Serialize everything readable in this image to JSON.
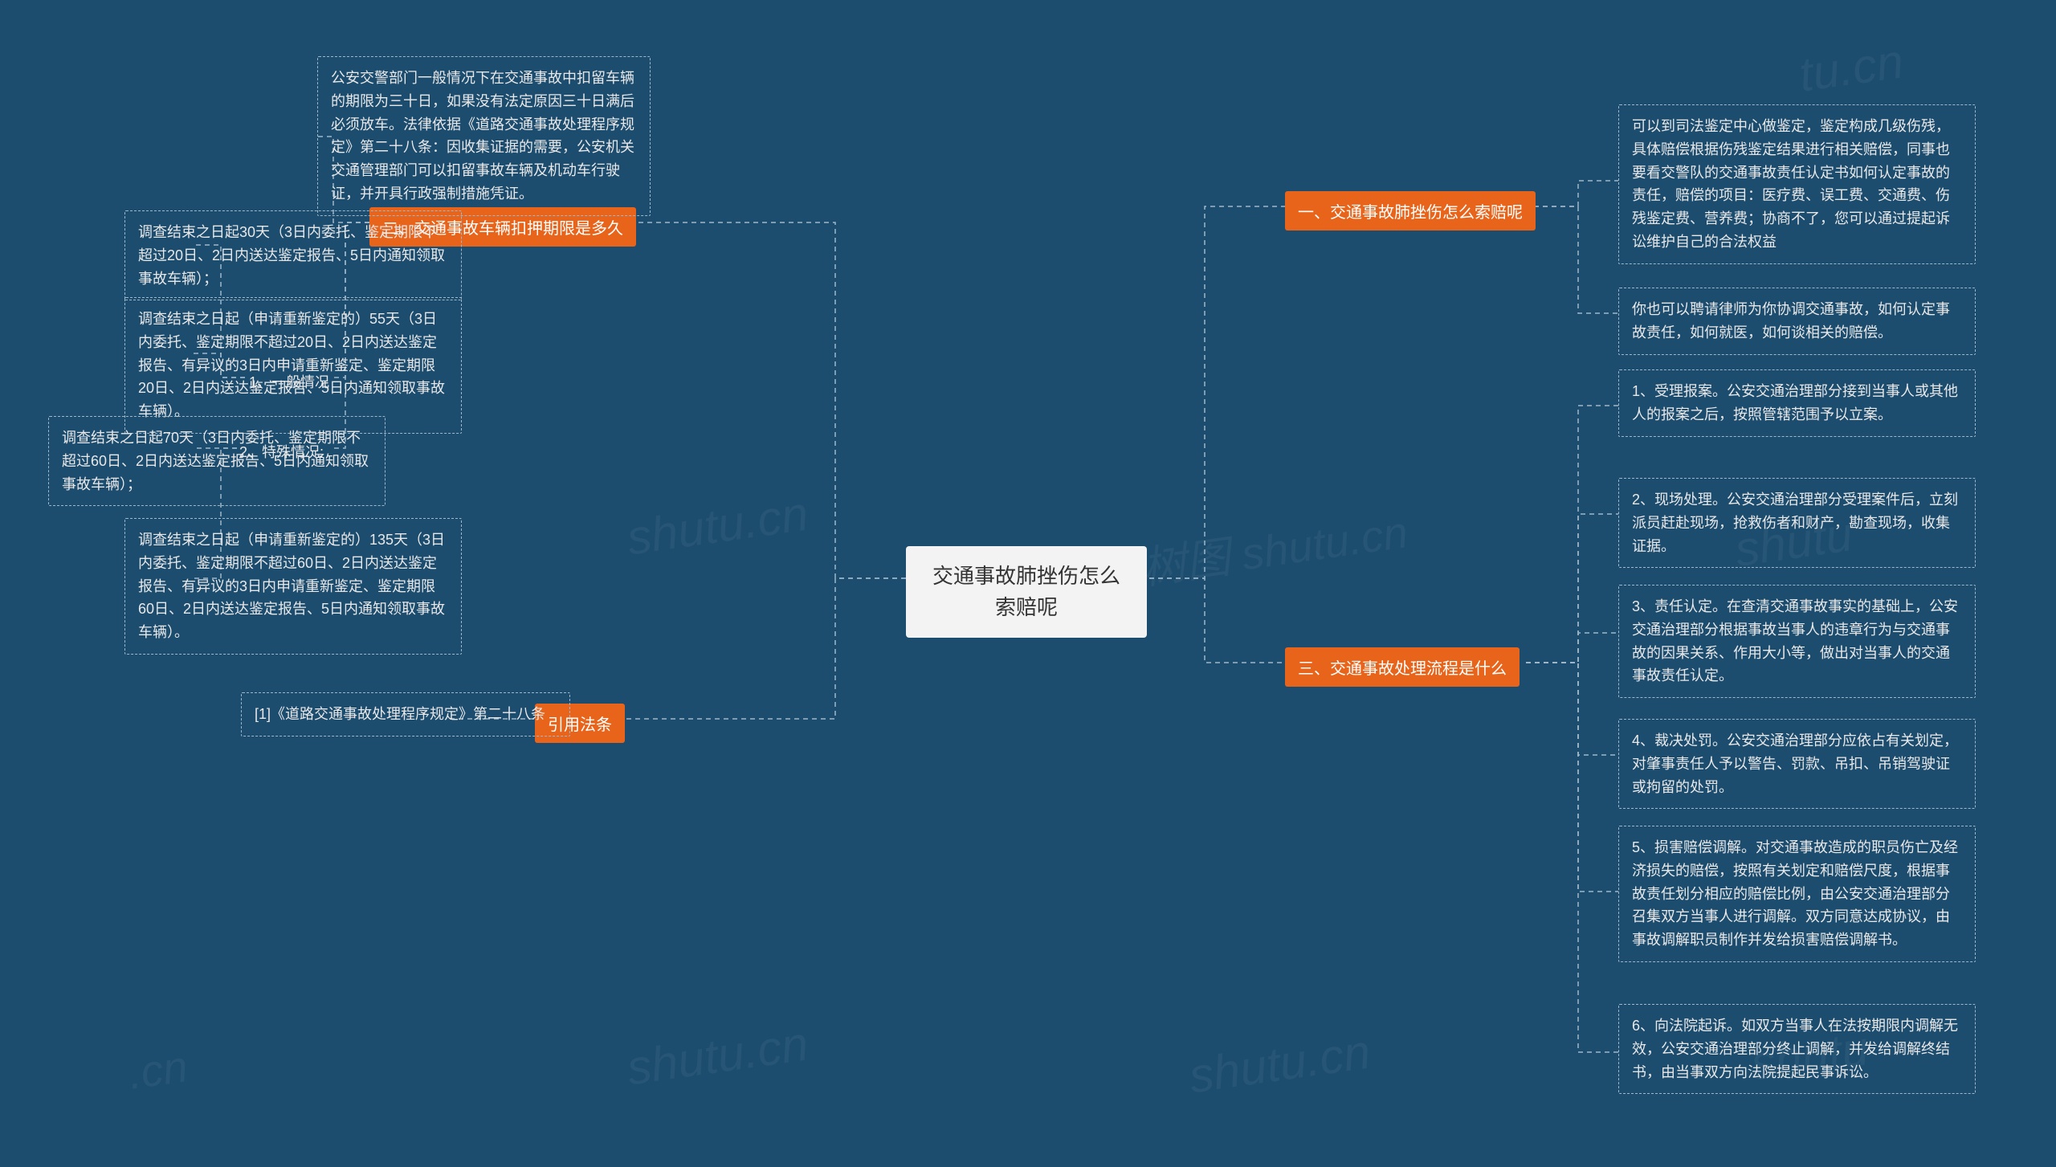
{
  "center": "交通事故肺挫伤怎么索赔呢",
  "right": {
    "b1": {
      "label": "一、交通事故肺挫伤怎么索赔呢",
      "c1": "可以到司法鉴定中心做鉴定，鉴定构成几级伤残，具体赔偿根据伤残鉴定结果进行相关赔偿，同事也要看交警队的交通事故责任认定书如何认定事故的责任，赔偿的项目：医疗费、误工费、交通费、伤残鉴定费、营养费；协商不了，您可以通过提起诉讼维护自己的合法权益",
      "c2": "你也可以聘请律师为你协调交通事故，如何认定事故责任，如何就医，如何谈相关的赔偿。"
    },
    "b3": {
      "label": "三、交通事故处理流程是什么",
      "c1": "1、受理报案。公安交通治理部分接到当事人或其他人的报案之后，按照管辖范围予以立案。",
      "c2": "2、现场处理。公安交通治理部分受理案件后，立刻派员赶赴现场，抢救伤者和财产，勘查现场，收集证据。",
      "c3": "3、责任认定。在查清交通事故事实的基础上，公安交通治理部分根据事故当事人的违章行为与交通事故的因果关系、作用大小等，做出对当事人的交通事故责任认定。",
      "c4": "4、裁决处罚。公安交通治理部分应依占有关划定，对肇事责任人予以警告、罚款、吊扣、吊销驾驶证或拘留的处罚。",
      "c5": "5、损害赔偿调解。对交通事故造成的职员伤亡及经济损失的赔偿，按照有关划定和赔偿尺度，根据事故责任划分相应的赔偿比例，由公安交通治理部分召集双方当事人进行调解。双方同意达成协议，由事故调解职员制作并发给损害赔偿调解书。",
      "c6": "6、向法院起诉。如双方当事人在法按期限内调解无效，公安交通治理部分终止调解，并发给调解终结书，由当事双方向法院提起民事诉讼。"
    }
  },
  "left": {
    "b2": {
      "label": "二、交通事故车辆扣押期限是多久",
      "top": "公安交警部门一般情况下在交通事故中扣留车辆的期限为三十日，如果没有法定原因三十日满后必须放车。法律依据《道路交通事故处理程序规定》第二十八条：因收集证据的需要，公安机关交通管理部门可以扣留事故车辆及机动车行驶证，并开具行政强制措施凭证。",
      "s1": {
        "label": "1、一般情况",
        "c1": "调查结束之日起30天（3日内委托、鉴定期限不超过20日、2日内送达鉴定报告、5日内通知领取事故车辆）；",
        "c2": "调查结束之日起（申请重新鉴定的）55天（3日内委托、鉴定期限不超过20日、2日内送达鉴定报告、有异议的3日内申请重新鉴定、鉴定期限20日、2日内送达鉴定报告、5日内通知领取事故车辆）。"
      },
      "s2": {
        "label": "2、特殊情况:",
        "c1": "调查结束之日起70天（3日内委托、鉴定期限不超过60日、2日内送达鉴定报告、5日内通知领取事故车辆）；",
        "c2": "调查结束之日起（申请重新鉴定的）135天（3日内委托、鉴定期限不超过60日、2日内送达鉴定报告、有异议的3日内申请重新鉴定、鉴定期限60日、2日内送达鉴定报告、5日内通知领取事故车辆）。"
      }
    },
    "bLaw": {
      "label": "引用法条",
      "c1": "[1]《道路交通事故处理程序规定》第二十八条"
    }
  }
}
